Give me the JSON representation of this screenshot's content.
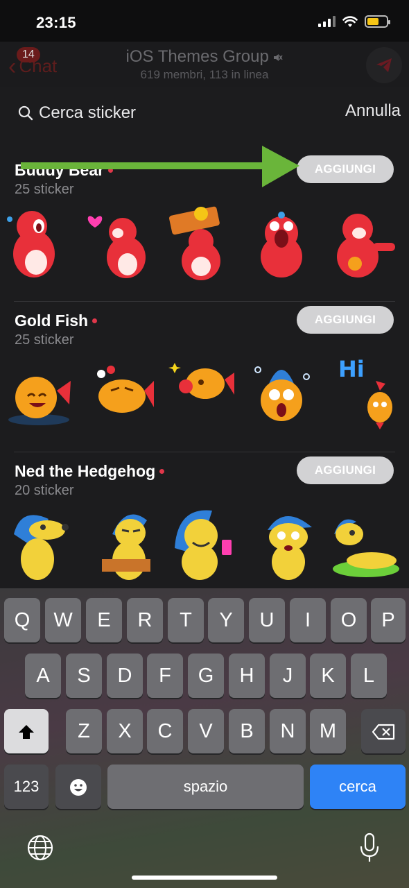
{
  "status_bar": {
    "time": "23:15"
  },
  "chat_header": {
    "back_label": "Chat",
    "unread_badge": "14",
    "title": "iOS Themes Group",
    "subtitle": "619 membri, 113 in linea"
  },
  "search": {
    "placeholder": "Cerca sticker",
    "cancel_label": "Annulla"
  },
  "packs": [
    {
      "title": "Buddy Bear",
      "count": "25 sticker",
      "add_label": "AGGIUNGI"
    },
    {
      "title": "Gold Fish",
      "count": "25 sticker",
      "add_label": "AGGIUNGI"
    },
    {
      "title": "Ned the Hedgehog",
      "count": "20 sticker",
      "add_label": "AGGIUNGI"
    }
  ],
  "keyboard": {
    "row1": [
      "Q",
      "W",
      "E",
      "R",
      "T",
      "Y",
      "U",
      "I",
      "O",
      "P"
    ],
    "row2": [
      "A",
      "S",
      "D",
      "F",
      "G",
      "H",
      "J",
      "K",
      "L"
    ],
    "row3": [
      "Z",
      "X",
      "C",
      "V",
      "B",
      "N",
      "M"
    ],
    "numbers_label": "123",
    "space_label": "spazio",
    "search_label": "cerca"
  },
  "colors": {
    "accent_blue": "#2e83f6",
    "new_dot": "#e0374a",
    "arrow_green": "#6ab53a",
    "bear_red": "#e8303a",
    "fish_orange": "#f5a01c",
    "hedgehog_yellow": "#f2d13a",
    "hedgehog_blue": "#2f7fd8"
  },
  "icons": [
    "search-icon",
    "back-chevron-icon",
    "muted-speaker-icon",
    "send-icon",
    "shift-icon",
    "emoji-icon",
    "backspace-icon",
    "globe-icon",
    "microphone-icon"
  ]
}
